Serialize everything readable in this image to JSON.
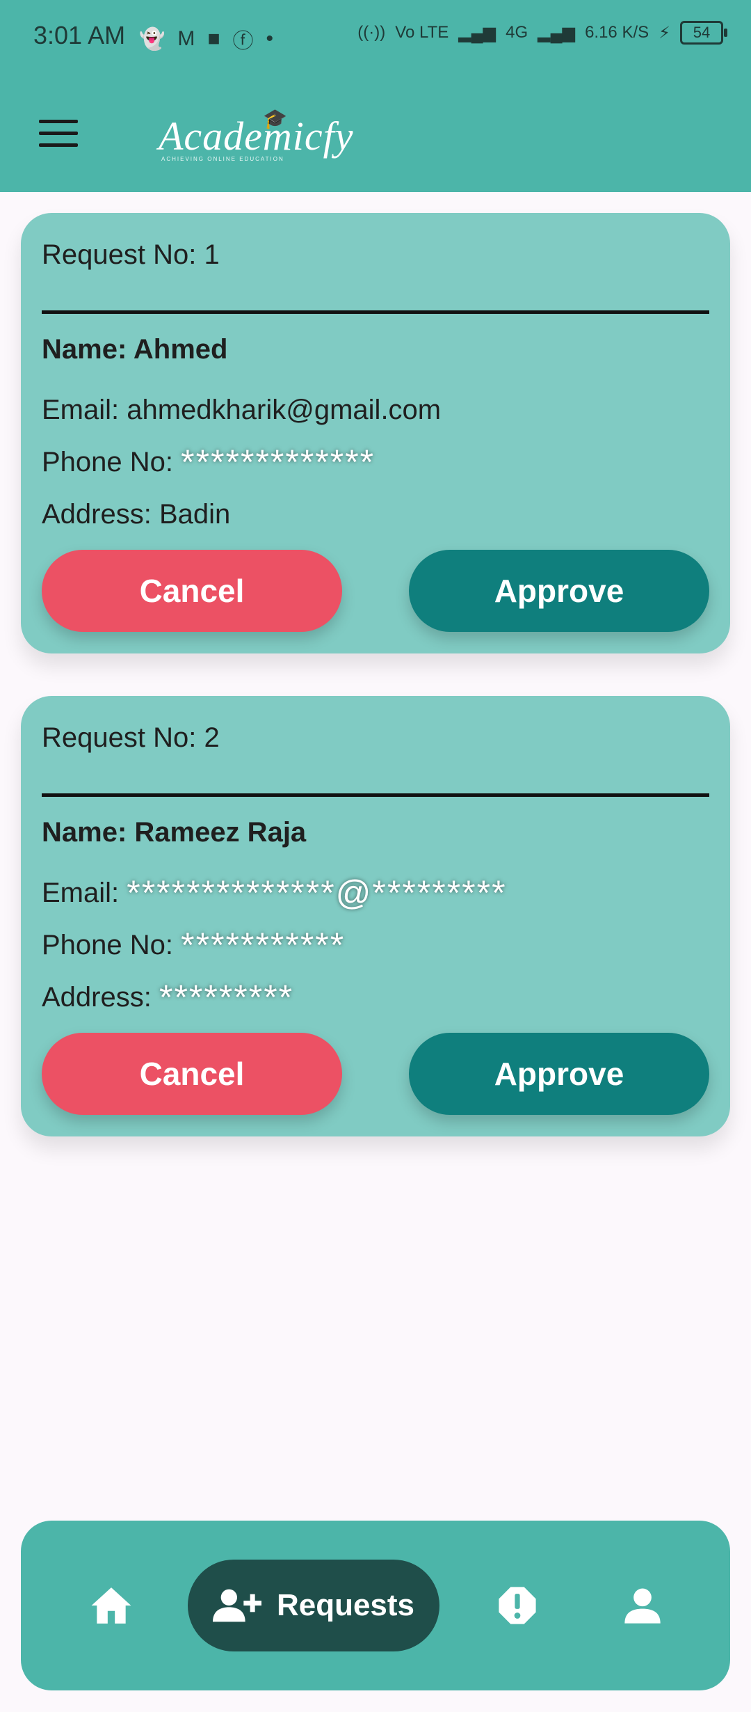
{
  "status_bar": {
    "time": "3:01 AM",
    "network_label": "4G",
    "lte_label": "Vo LTE",
    "speed": "6.16",
    "speed_unit": "K/S",
    "battery": "54"
  },
  "app_bar": {
    "logo_text": "Academicfy",
    "logo_tagline": "ACHIEVING ONLINE EDUCATION"
  },
  "requests": [
    {
      "title": "Request No: 1",
      "name_label": "Name: Ahmed",
      "email_label": "Email: ahmedkharik@gmail.com",
      "email_mask": "",
      "phone_label": "Phone No:",
      "phone_mask": "*************",
      "address_label": "Address: Badin",
      "address_mask": "",
      "cancel_label": "Cancel",
      "approve_label": "Approve"
    },
    {
      "title": "Request No: 2",
      "name_label": "Name: Rameez Raja",
      "email_label": "Email:",
      "email_mask": "**************@*********",
      "phone_label": "Phone No:",
      "phone_mask": "***********",
      "address_label": "Address:",
      "address_mask": "*********",
      "cancel_label": "Cancel",
      "approve_label": "Approve"
    }
  ],
  "bottom_nav": {
    "requests_label": "Requests",
    "items": [
      "home-icon",
      "add-person-icon",
      "alert-icon",
      "person-icon"
    ]
  },
  "colors": {
    "primary": "#4CB5A9",
    "card": "#80CBC3",
    "cancel": "#EC5164",
    "approve": "#0F7F7D",
    "nav_active": "#1F4E4A",
    "background": "#FCF8FC"
  }
}
